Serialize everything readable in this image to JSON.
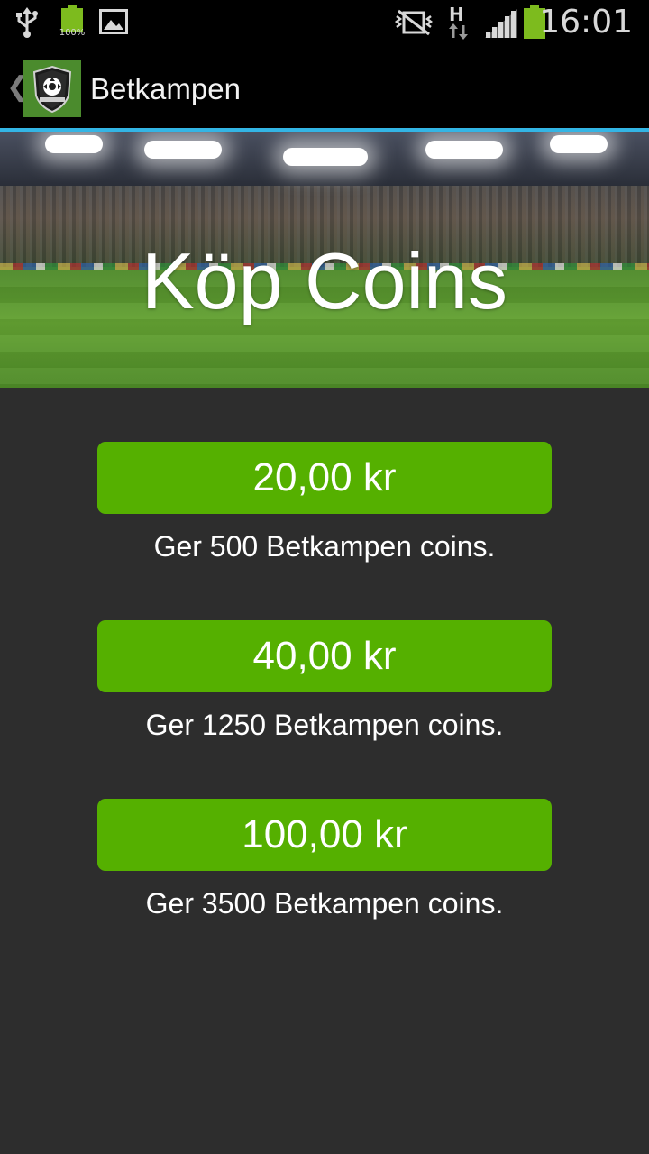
{
  "status_bar": {
    "icons": [
      "usb-icon",
      "battery-full-icon",
      "image-icon",
      "vibrate-off-icon",
      "hspa-data-icon",
      "signal-icon",
      "battery-icon"
    ],
    "battery_badge": "100%",
    "network_type": "H",
    "time": "16:01"
  },
  "action_bar": {
    "title": "Betkampen",
    "logo_icon": "betkampen-shield-logo",
    "up_icon": "chevron-left-icon"
  },
  "hero": {
    "title": "Köp Coins"
  },
  "offers": [
    {
      "price": "20,00 kr",
      "description": "Ger 500 Betkampen coins."
    },
    {
      "price": "40,00 kr",
      "description": "Ger 1250 Betkampen coins."
    },
    {
      "price": "100,00 kr",
      "description": "Ger 3500 Betkampen coins."
    }
  ],
  "colors": {
    "accent_divider": "#33b5e5",
    "button_green": "#55b000",
    "background": "#2d2d2d"
  }
}
